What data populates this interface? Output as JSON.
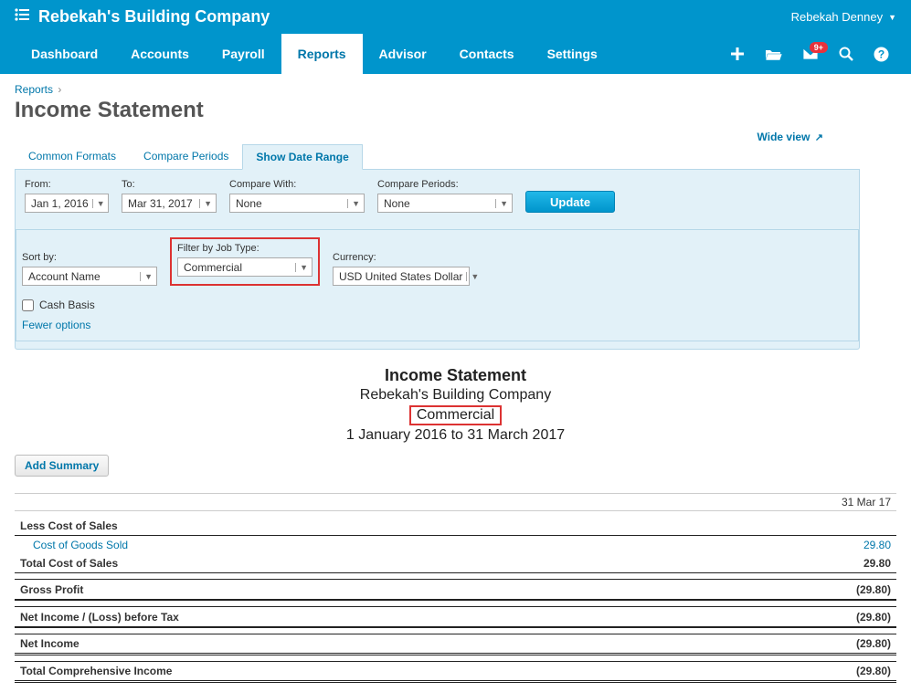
{
  "header": {
    "company_name": "Rebekah's Building Company",
    "user_name": "Rebekah Denney"
  },
  "nav": {
    "items": [
      "Dashboard",
      "Accounts",
      "Payroll",
      "Reports",
      "Advisor",
      "Contacts",
      "Settings"
    ],
    "active_index": 3,
    "notification_badge": "9+"
  },
  "breadcrumb": {
    "link": "Reports"
  },
  "page_title": "Income Statement",
  "wide_view_label": "Wide view",
  "tabs": {
    "items": [
      "Common Formats",
      "Compare Periods",
      "Show Date Range"
    ],
    "active_index": 2
  },
  "filters": {
    "from": {
      "label": "From:",
      "value": "Jan 1, 2016"
    },
    "to": {
      "label": "To:",
      "value": "Mar 31, 2017"
    },
    "compare_with": {
      "label": "Compare With:",
      "value": "None"
    },
    "compare_periods": {
      "label": "Compare Periods:",
      "value": "None"
    },
    "update_label": "Update",
    "sort_by": {
      "label": "Sort by:",
      "value": "Account Name"
    },
    "job_type": {
      "label": "Filter by Job Type:",
      "value": "Commercial"
    },
    "currency": {
      "label": "Currency:",
      "value": "USD United States Dollar"
    },
    "cash_basis_label": "Cash Basis",
    "fewer_options_label": "Fewer options"
  },
  "report": {
    "title": "Income Statement",
    "company": "Rebekah's Building Company",
    "job_type": "Commercial",
    "date_range": "1 January 2016 to 31 March 2017",
    "add_summary_label": "Add Summary",
    "date_column": "31 Mar 17",
    "sections": {
      "less_cost_of_sales_label": "Less Cost of Sales",
      "cost_of_goods_sold": {
        "label": "Cost of Goods Sold",
        "value": "29.80"
      },
      "total_cost_of_sales": {
        "label": "Total Cost of Sales",
        "value": "29.80"
      },
      "gross_profit": {
        "label": "Gross Profit",
        "value": "(29.80)"
      },
      "net_income_before_tax": {
        "label": "Net Income / (Loss) before Tax",
        "value": "(29.80)"
      },
      "net_income": {
        "label": "Net Income",
        "value": "(29.80)"
      },
      "total_comprehensive": {
        "label": "Total Comprehensive Income",
        "value": "(29.80)"
      }
    }
  }
}
